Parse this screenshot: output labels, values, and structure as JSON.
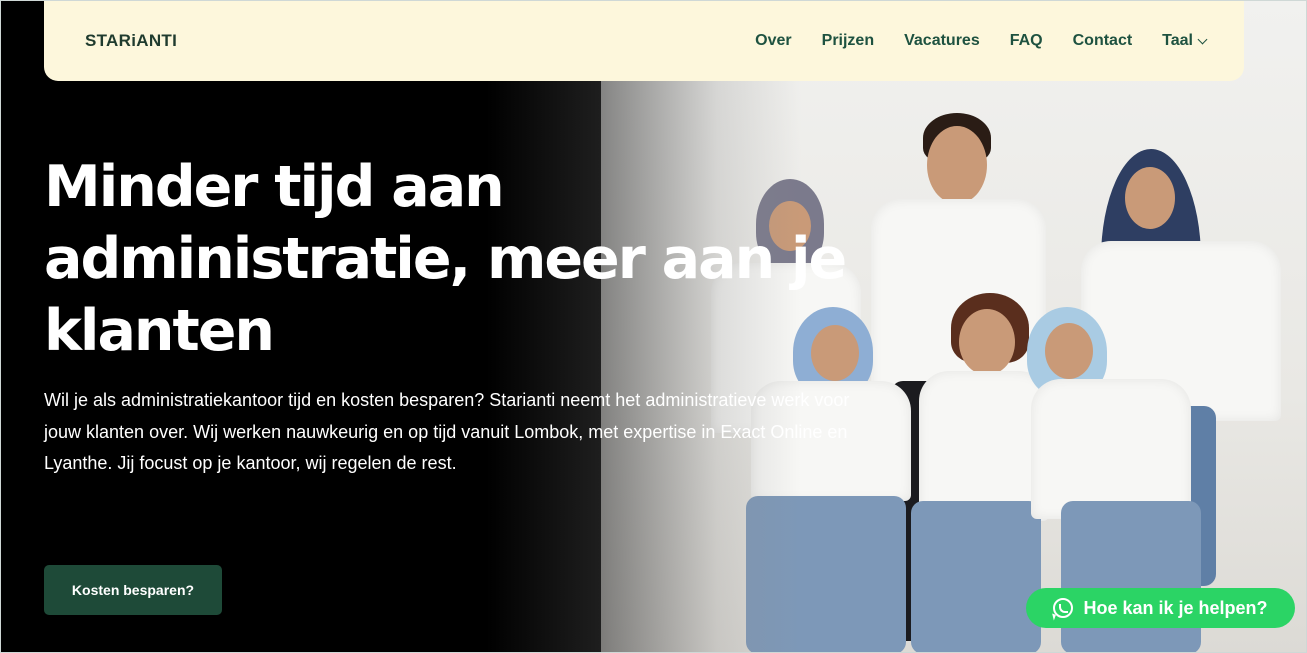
{
  "brand": {
    "logo": "STARiANTI"
  },
  "nav": {
    "items": [
      {
        "label": "Over"
      },
      {
        "label": "Prijzen"
      },
      {
        "label": "Vacatures"
      },
      {
        "label": "FAQ"
      },
      {
        "label": "Contact"
      }
    ],
    "language": {
      "label": "Taal",
      "icon": "chevron-down-icon"
    }
  },
  "hero": {
    "title": "Minder tijd aan administratie, meer aan je klanten",
    "text": "Wil je als administratiekantoor tijd en kosten besparen? Starianti neemt het administratieve werk voor jouw klanten over. Wij werken nauwkeurig en op tijd vanuit Lombok, met expertise in Exact Online en Lyanthe. Jij focust op je kantoor, wij regelen de rest.",
    "cta_label": "Kosten besparen?"
  },
  "chat": {
    "label": "Hoe kan ik je helpen?",
    "icon": "whatsapp-icon"
  },
  "colors": {
    "header_bg": "#fdf7dc",
    "brand_green": "#1e4a38",
    "nav_text": "#1e5240",
    "whatsapp": "#2bd465"
  }
}
